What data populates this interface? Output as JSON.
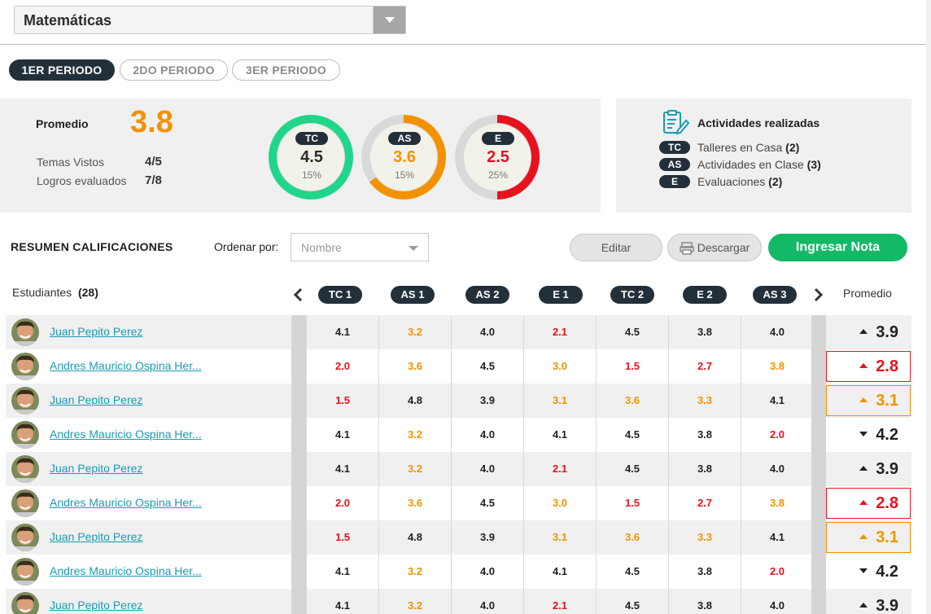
{
  "subject_select": {
    "value": "Matemáticas"
  },
  "period_tabs": [
    {
      "label": "1ER PERIODO",
      "active": true
    },
    {
      "label": "2DO PERIODO",
      "active": false
    },
    {
      "label": "3ER PERIODO",
      "active": false
    }
  ],
  "summary": {
    "promedio_label": "Promedio",
    "promedio_value": "3.8",
    "temas_label": "Temas Vistos",
    "temas_value": "4/5",
    "logros_label": "Logros evaluados",
    "logros_value": "7/8",
    "rings": [
      {
        "code": "TC",
        "value": "4.5",
        "pct": "15%",
        "color": "#1fd68a",
        "fill": 1.0
      },
      {
        "code": "AS",
        "value": "3.6",
        "pct": "15%",
        "color": "#f39200",
        "fill": 0.65
      },
      {
        "code": "E",
        "value": "2.5",
        "pct": "25%",
        "color": "#e8121e",
        "fill": 0.5
      }
    ]
  },
  "activities": {
    "title": "Actividades realizadas",
    "items": [
      {
        "code": "TC",
        "label": "Talleres en Casa",
        "count": "(2)"
      },
      {
        "code": "AS",
        "label": "Actividades en Clase",
        "count": "(3)"
      },
      {
        "code": "E",
        "label": "Evaluaciones",
        "count": "(2)"
      }
    ]
  },
  "toolbar": {
    "title": "RESUMEN CALIFICACIONES",
    "order_label": "Ordenar por:",
    "order_placeholder": "Nombre",
    "edit_label": "Editar",
    "download_label": "Descargar",
    "add_grade_label": "Ingresar Nota"
  },
  "grades_header": {
    "students_label": "Estudiantes",
    "students_count": "(28)",
    "columns": [
      "TC 1",
      "AS 1",
      "AS 2",
      "E 1",
      "TC 2",
      "E 2",
      "AS 3"
    ],
    "promedio_label": "Promedio"
  },
  "colors": {
    "good": "#222222",
    "warn": "#f39200",
    "bad": "#e8121e"
  },
  "rows": [
    {
      "name": "Juan Pepito Perez",
      "grades": [
        [
          "4.1",
          "good"
        ],
        [
          "3.2",
          "warn"
        ],
        [
          "4.0",
          "good"
        ],
        [
          "2.1",
          "bad"
        ],
        [
          "4.5",
          "good"
        ],
        [
          "3.8",
          "good"
        ],
        [
          "4.0",
          "good"
        ]
      ],
      "avg": "3.9",
      "trend": "up",
      "status": "good"
    },
    {
      "name": "Andres Mauricio Ospina Her...",
      "grades": [
        [
          "2.0",
          "bad"
        ],
        [
          "3.6",
          "warn"
        ],
        [
          "4.5",
          "good"
        ],
        [
          "3.0",
          "warn"
        ],
        [
          "1.5",
          "bad"
        ],
        [
          "2.7",
          "bad"
        ],
        [
          "3.8",
          "warn"
        ]
      ],
      "avg": "2.8",
      "trend": "up",
      "status": "bad"
    },
    {
      "name": "Juan Pepito Perez",
      "grades": [
        [
          "1.5",
          "bad"
        ],
        [
          "4.8",
          "good"
        ],
        [
          "3.9",
          "good"
        ],
        [
          "3.1",
          "warn"
        ],
        [
          "3.6",
          "warn"
        ],
        [
          "3.3",
          "warn"
        ],
        [
          "4.1",
          "good"
        ]
      ],
      "avg": "3.1",
      "trend": "up",
      "status": "warn"
    },
    {
      "name": "Andres Mauricio Ospina Her...",
      "grades": [
        [
          "4.1",
          "good"
        ],
        [
          "3.2",
          "warn"
        ],
        [
          "4.0",
          "good"
        ],
        [
          "4.1",
          "good"
        ],
        [
          "4.5",
          "good"
        ],
        [
          "3.8",
          "good"
        ],
        [
          "2.0",
          "bad"
        ]
      ],
      "avg": "4.2",
      "trend": "down",
      "status": "good"
    },
    {
      "name": "Juan Pepito Perez",
      "grades": [
        [
          "4.1",
          "good"
        ],
        [
          "3.2",
          "warn"
        ],
        [
          "4.0",
          "good"
        ],
        [
          "2.1",
          "bad"
        ],
        [
          "4.5",
          "good"
        ],
        [
          "3.8",
          "good"
        ],
        [
          "4.0",
          "good"
        ]
      ],
      "avg": "3.9",
      "trend": "up",
      "status": "good"
    },
    {
      "name": "Andres Mauricio Ospina Her...",
      "grades": [
        [
          "2.0",
          "bad"
        ],
        [
          "3.6",
          "warn"
        ],
        [
          "4.5",
          "good"
        ],
        [
          "3.0",
          "warn"
        ],
        [
          "1.5",
          "bad"
        ],
        [
          "2.7",
          "bad"
        ],
        [
          "3.8",
          "warn"
        ]
      ],
      "avg": "2.8",
      "trend": "up",
      "status": "bad"
    },
    {
      "name": "Juan Pepito Perez",
      "grades": [
        [
          "1.5",
          "bad"
        ],
        [
          "4.8",
          "good"
        ],
        [
          "3.9",
          "good"
        ],
        [
          "3.1",
          "warn"
        ],
        [
          "3.6",
          "warn"
        ],
        [
          "3.3",
          "warn"
        ],
        [
          "4.1",
          "good"
        ]
      ],
      "avg": "3.1",
      "trend": "up",
      "status": "warn"
    },
    {
      "name": "Andres Mauricio Ospina Her...",
      "grades": [
        [
          "4.1",
          "good"
        ],
        [
          "3.2",
          "warn"
        ],
        [
          "4.0",
          "good"
        ],
        [
          "4.1",
          "good"
        ],
        [
          "4.5",
          "good"
        ],
        [
          "3.8",
          "good"
        ],
        [
          "2.0",
          "bad"
        ]
      ],
      "avg": "4.2",
      "trend": "down",
      "status": "good"
    },
    {
      "name": "Juan Pepito Perez",
      "grades": [
        [
          "4.1",
          "good"
        ],
        [
          "3.2",
          "warn"
        ],
        [
          "4.0",
          "good"
        ],
        [
          "2.1",
          "bad"
        ],
        [
          "4.5",
          "good"
        ],
        [
          "3.8",
          "good"
        ],
        [
          "4.0",
          "good"
        ]
      ],
      "avg": "3.9",
      "trend": "up",
      "status": "good"
    }
  ]
}
